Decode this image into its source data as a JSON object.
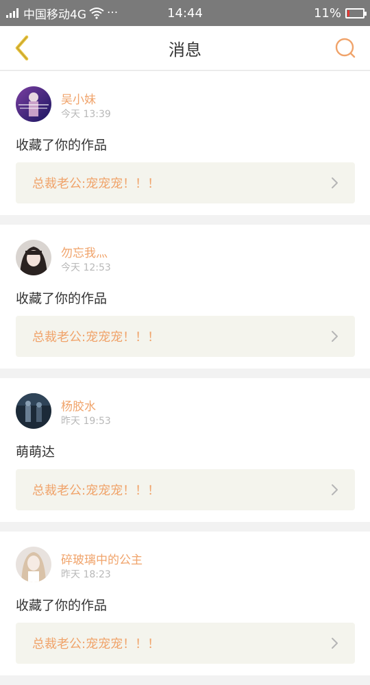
{
  "status_bar": {
    "carrier": "中国移动4G",
    "dots": "···",
    "time": "14:44",
    "battery": "11%",
    "battery_level": 0.11
  },
  "header": {
    "title": "消息",
    "back_icon": "chevron-left-icon",
    "search_icon": "search-icon"
  },
  "colors": {
    "accent": "#f0a36a",
    "back_icon": "#e8c23a",
    "status_bar": "#7a7a7a",
    "card_bg": "#ffffff",
    "work_bg": "#f4f4ed"
  },
  "messages": [
    {
      "name": "吴小妹",
      "time": "今天 13:39",
      "content": "收藏了你的作品",
      "work_title": "总裁老公:宠宠宠！！！"
    },
    {
      "name": "勿忘我灬",
      "time": "今天 12:53",
      "content": "收藏了你的作品",
      "work_title": "总裁老公:宠宠宠！！！"
    },
    {
      "name": "杨胶水",
      "time": "昨天 19:53",
      "content": "萌萌达",
      "work_title": "总裁老公:宠宠宠！！！"
    },
    {
      "name": "碎玻璃中的公主",
      "time": "昨天 18:23",
      "content": "收藏了你的作品",
      "work_title": "总裁老公:宠宠宠！！！"
    }
  ]
}
